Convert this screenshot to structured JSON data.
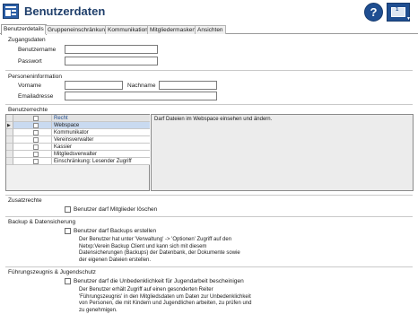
{
  "header": {
    "title": "Benutzerdaten",
    "help_label": "?",
    "window_number": "1",
    "accent": "#1f4e91"
  },
  "tabs": [
    {
      "label": "Benutzerdetails",
      "active": true
    },
    {
      "label": "Gruppeneinschränkung",
      "active": false
    },
    {
      "label": "Kommunikation",
      "active": false
    },
    {
      "label": "Mitgliedermasken",
      "active": false
    },
    {
      "label": "Ansichten",
      "active": false
    }
  ],
  "access": {
    "title": "Zugangsdaten",
    "username_label": "Benutzername",
    "username_value": "",
    "password_label": "Passwort",
    "password_value": ""
  },
  "person": {
    "title": "Personeninformation",
    "firstname_label": "Vorname",
    "firstname_value": "",
    "lastname_label": "Nachname",
    "lastname_value": "",
    "email_label": "Emailadresse",
    "email_value": ""
  },
  "rights": {
    "title": "Benutzerrechte",
    "column_header": "Recht",
    "rows": [
      {
        "label": "Webspace",
        "selected": true
      },
      {
        "label": "Kommunikator",
        "selected": false
      },
      {
        "label": "Vereinsverwalter",
        "selected": false
      },
      {
        "label": "Kassier",
        "selected": false
      },
      {
        "label": "Mitgliedsverwalter",
        "selected": false
      },
      {
        "label": "Einschränkung: Lesender Zugriff",
        "selected": false
      }
    ],
    "description": "Darf Dateien im Webspace einsehen und ändern."
  },
  "additional": {
    "title": "Zusatzrechte",
    "checkbox_label": "Benutzer darf Mitglieder löschen"
  },
  "backup": {
    "title": "Backup & Datensicherung",
    "checkbox_label": "Benutzer darf Backups erstellen",
    "text_lines": [
      "Der Benutzer hat unter 'Verwaltung' -> 'Optionen' Zugriff auf den",
      "Netxp:Verein Backup Client und kann sich mit diesem",
      "Datensicherungen (Backups) der Datenbank, der Dokumente sowie",
      "der eigenen Dateien erstellen."
    ]
  },
  "youth": {
    "title": "Führungszeugnis & Jugendschutz",
    "checkbox_label": "Benutzer darf die Unbedenklichkeit für Jugendarbeit bescheinigen",
    "text_lines": [
      "Der Benutzer erhält Zugriff auf einen gesonderten Reiter",
      "'Führungszeugnis' in den Mitgliedsdaten um Daten zur Unbedenklichkeit",
      "von Personen, die mit Kindern und Jugendlichen arbeiten, zu prüfen und",
      "zu genehmigen."
    ]
  }
}
